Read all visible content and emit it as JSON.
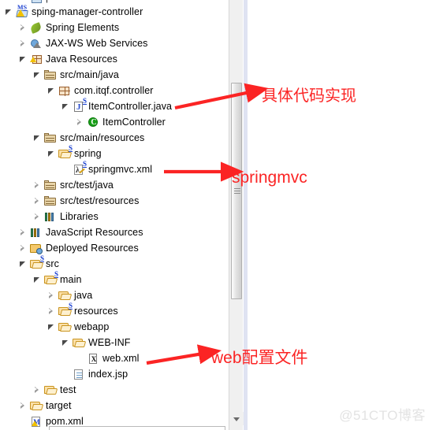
{
  "explorer": {
    "name": "package-explorer",
    "scrollbar": {
      "down_arrow": "▼"
    },
    "rows": [
      {
        "label": "sping-manager-controller",
        "indent": 0,
        "twisty": "expanded",
        "icon": "maven-spring-project-icon"
      },
      {
        "label": "Spring Elements",
        "indent": 1,
        "twisty": "collapsed",
        "icon": "spring-leaf-icon"
      },
      {
        "label": "JAX-WS Web Services",
        "indent": 1,
        "twisty": "collapsed",
        "icon": "web-services-icon"
      },
      {
        "label": "Java Resources",
        "indent": 1,
        "twisty": "expanded",
        "icon": "java-resources-icon"
      },
      {
        "label": "src/main/java",
        "indent": 2,
        "twisty": "expanded",
        "icon": "source-folder-icon"
      },
      {
        "label": "com.itqf.controller",
        "indent": 3,
        "twisty": "expanded",
        "icon": "package-icon"
      },
      {
        "label": "ItemController.java",
        "indent": 4,
        "twisty": "expanded",
        "icon": "java-file-icon"
      },
      {
        "label": "ItemController",
        "indent": 5,
        "twisty": "collapsed",
        "icon": "java-class-icon"
      },
      {
        "label": "src/main/resources",
        "indent": 2,
        "twisty": "expanded",
        "icon": "source-folder-icon"
      },
      {
        "label": "spring",
        "indent": 3,
        "twisty": "expanded",
        "icon": "spring-folder-icon"
      },
      {
        "label": "springmvc.xml",
        "indent": 4,
        "twisty": "none",
        "icon": "spring-xml-file-icon"
      },
      {
        "label": "src/test/java",
        "indent": 2,
        "twisty": "collapsed",
        "icon": "source-folder-icon"
      },
      {
        "label": "src/test/resources",
        "indent": 2,
        "twisty": "collapsed",
        "icon": "source-folder-icon"
      },
      {
        "label": "Libraries",
        "indent": 2,
        "twisty": "collapsed",
        "icon": "libraries-icon"
      },
      {
        "label": "JavaScript Resources",
        "indent": 1,
        "twisty": "collapsed",
        "icon": "libraries-icon"
      },
      {
        "label": "Deployed Resources",
        "indent": 1,
        "twisty": "collapsed",
        "icon": "deployed-resources-icon"
      },
      {
        "label": "src",
        "indent": 1,
        "twisty": "expanded",
        "icon": "spring-folder-icon"
      },
      {
        "label": "main",
        "indent": 2,
        "twisty": "expanded",
        "icon": "spring-folder-icon"
      },
      {
        "label": "java",
        "indent": 3,
        "twisty": "collapsed",
        "icon": "open-folder-icon"
      },
      {
        "label": "resources",
        "indent": 3,
        "twisty": "collapsed",
        "icon": "spring-folder-icon"
      },
      {
        "label": "webapp",
        "indent": 3,
        "twisty": "expanded",
        "icon": "open-folder-icon"
      },
      {
        "label": "WEB-INF",
        "indent": 4,
        "twisty": "expanded",
        "icon": "open-folder-icon"
      },
      {
        "label": "web.xml",
        "indent": 5,
        "twisty": "none",
        "icon": "xml-file-icon"
      },
      {
        "label": "index.jsp",
        "indent": 4,
        "twisty": "none",
        "icon": "jsp-file-icon"
      },
      {
        "label": "test",
        "indent": 2,
        "twisty": "collapsed",
        "icon": "open-folder-icon"
      },
      {
        "label": "target",
        "indent": 1,
        "twisty": "collapsed",
        "icon": "open-folder-icon"
      },
      {
        "label": "pom.xml",
        "indent": 1,
        "twisty": "none",
        "icon": "maven-pom-icon"
      }
    ]
  },
  "annotations": {
    "color": "#fb2424",
    "items": [
      {
        "text": "具体代码实现",
        "target": "ItemController.java"
      },
      {
        "text": "springmvc",
        "target": "springmvc.xml"
      },
      {
        "text": "web配置文件",
        "target": "web.xml"
      }
    ]
  },
  "watermark": {
    "text": "@51CTO博客",
    "color": "#e3e3e3"
  }
}
